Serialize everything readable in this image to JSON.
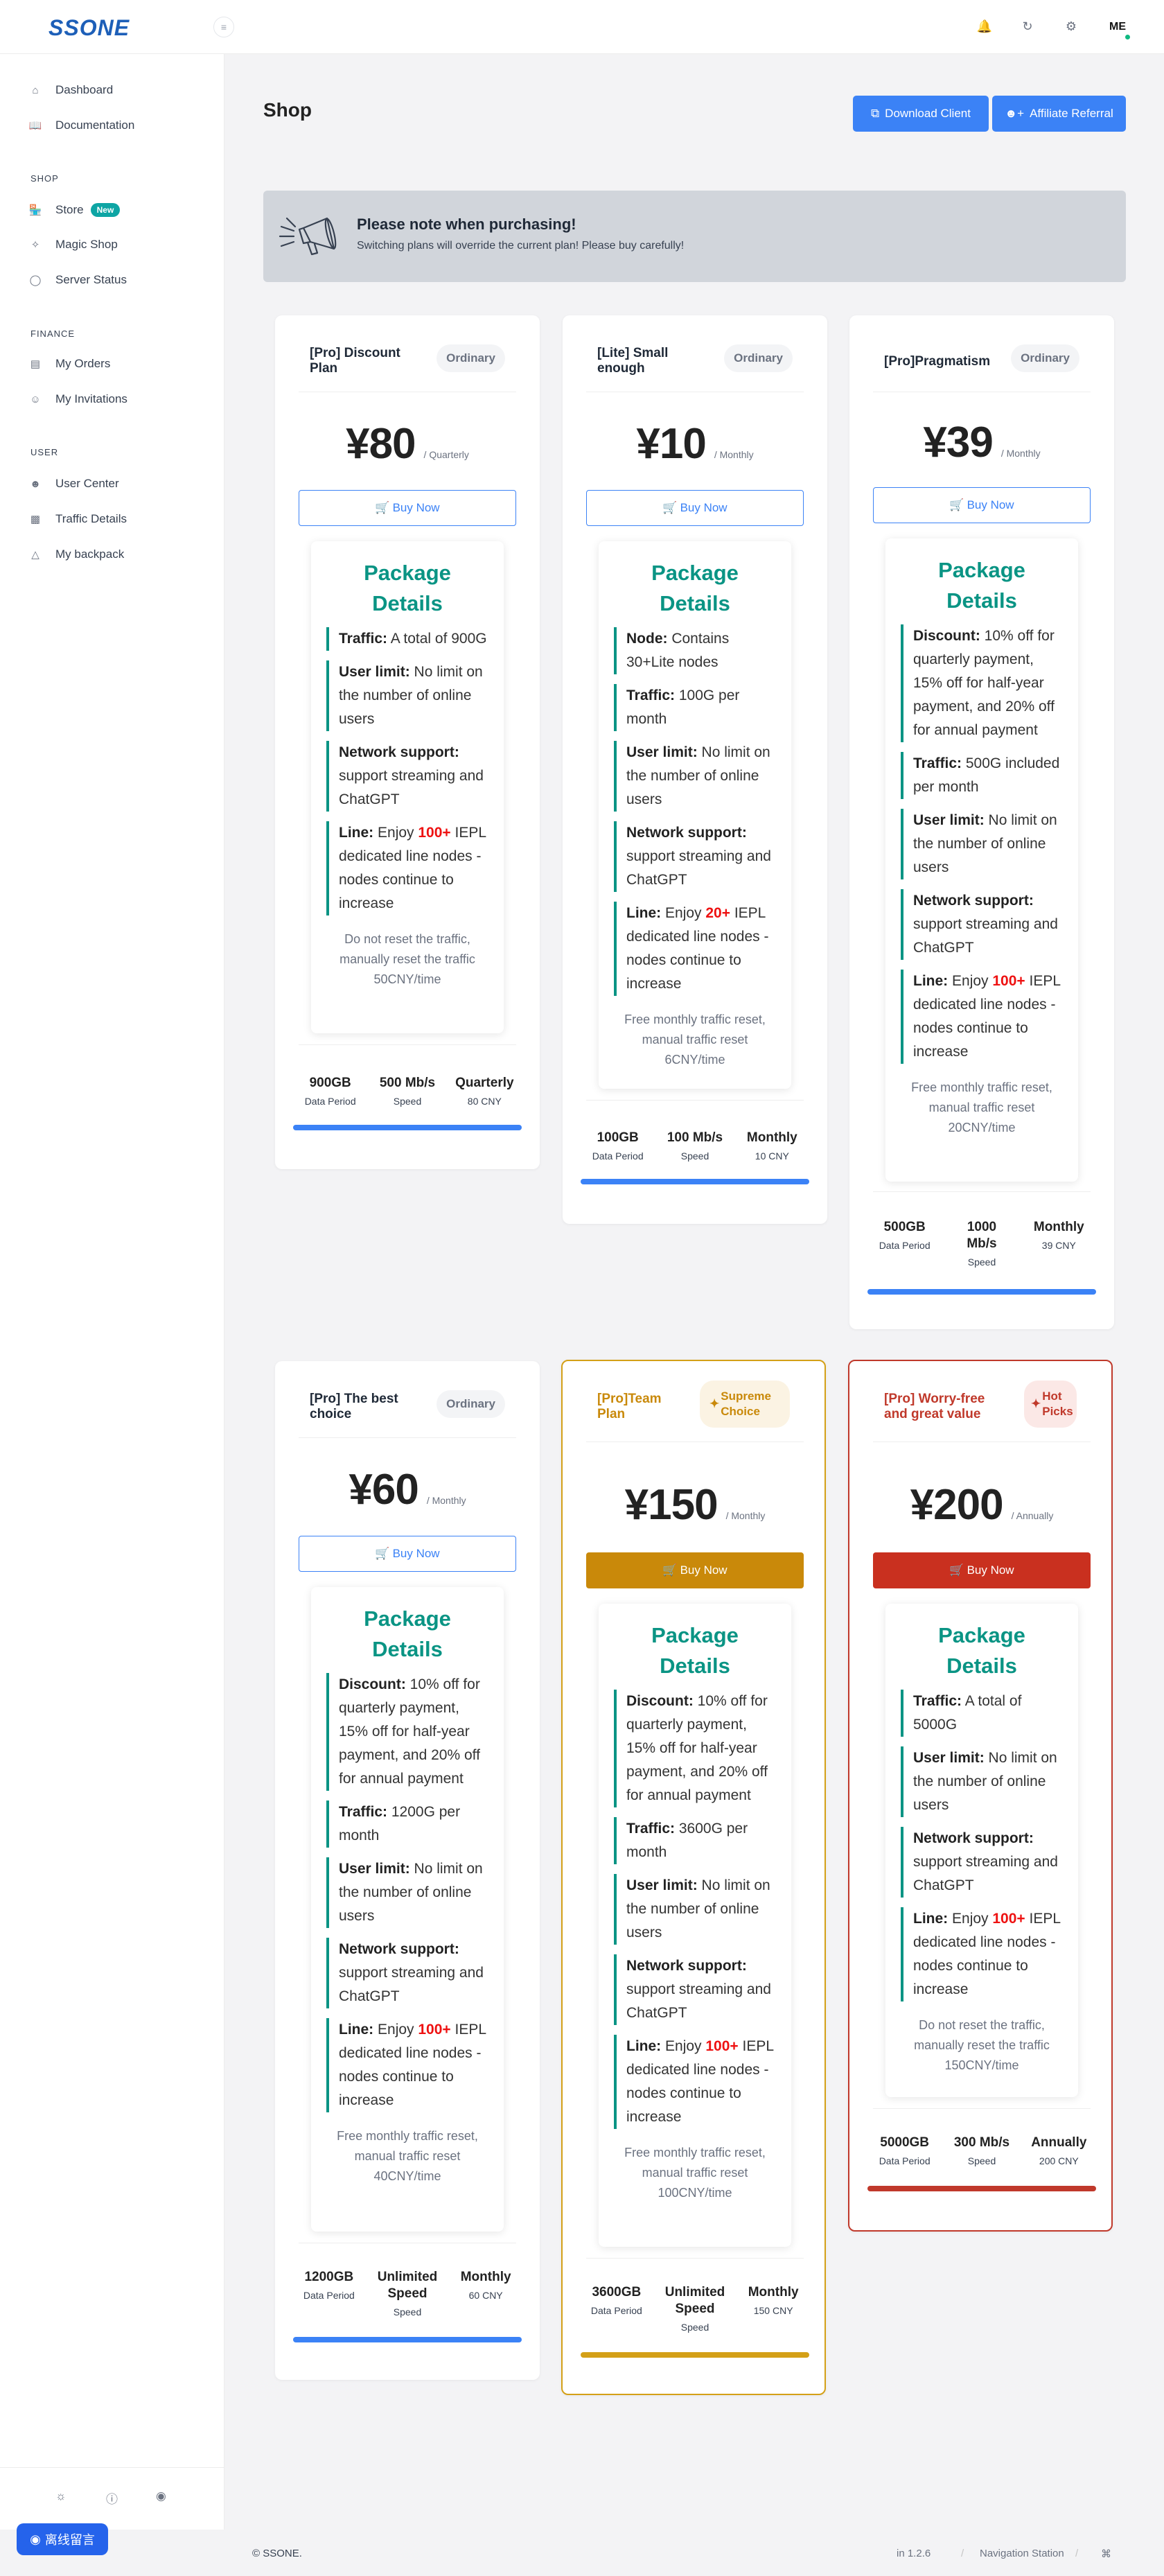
{
  "app": {
    "logo": "SSONE",
    "avatar_initials": "ME"
  },
  "sidebar": {
    "items_main": [
      {
        "label": "Dashboard"
      },
      {
        "label": "Documentation"
      }
    ],
    "sections": {
      "shop": "SHOP",
      "finance": "FINANCE",
      "user": "USER"
    },
    "shop_items": [
      {
        "label": "Store",
        "badge": "New"
      },
      {
        "label": "Magic Shop"
      },
      {
        "label": "Server Status"
      }
    ],
    "finance_items": [
      {
        "label": "My Orders"
      },
      {
        "label": "My Invitations"
      }
    ],
    "user_items": [
      {
        "label": "User Center"
      },
      {
        "label": "Traffic Details"
      },
      {
        "label": "My backpack"
      }
    ],
    "message_button": "离线留言"
  },
  "page": {
    "title": "Shop",
    "download_button": "Download Client",
    "affiliate_button": "Affiliate Referral"
  },
  "notice": {
    "title": "Please note when purchasing!",
    "text": "Switching plans will override the current plan! Please buy carefully!"
  },
  "common": {
    "buy_now": "Buy Now",
    "details_title": "Package Details",
    "data_period_label": "Data Period",
    "speed_label": "Speed"
  },
  "plans": [
    {
      "name": "[Pro] Discount Plan",
      "tag": "Ordinary",
      "price": "¥80",
      "period": "/ Quarterly",
      "features": [
        {
          "k": "Traffic:",
          "v": " A total of 900G"
        },
        {
          "k": "User limit:",
          "v": " No limit on the number of online users"
        },
        {
          "k": "Network support:",
          "v": " support streaming and ChatGPT"
        },
        {
          "k": "Line:",
          "v1": " Enjoy ",
          "hl": "100+",
          "v2": " IEPL dedicated line nodes - nodes continue to increase"
        }
      ],
      "note": "Do not reset the traffic, manually reset the traffic 50CNY/time",
      "stats": {
        "data": "900GB",
        "speed": "500 Mb/s",
        "cycle": "Quarterly",
        "cycle_price": "80 CNY"
      }
    },
    {
      "name": "[Lite] Small enough",
      "tag": "Ordinary",
      "price": "¥10",
      "period": "/ Monthly",
      "features": [
        {
          "k": "Node:",
          "v": " Contains 30+Lite nodes"
        },
        {
          "k": "Traffic:",
          "v": " 100G per month"
        },
        {
          "k": "User limit:",
          "v": " No limit on the number of online users"
        },
        {
          "k": "Network support:",
          "v": " support streaming and ChatGPT"
        },
        {
          "k": "Line:",
          "v1": " Enjoy ",
          "hl": "20+",
          "v2": " IEPL dedicated line nodes - nodes continue to increase"
        }
      ],
      "note": "Free monthly traffic reset, manual traffic reset 6CNY/time",
      "stats": {
        "data": "100GB",
        "speed": "100 Mb/s",
        "cycle": "Monthly",
        "cycle_price": "10 CNY"
      }
    },
    {
      "name": "[Pro]Pragmatism",
      "tag": "Ordinary",
      "price": "¥39",
      "period": "/ Monthly",
      "features": [
        {
          "k": "Discount:",
          "v": " 10% off for quarterly payment, 15% off for half-year payment, and 20% off for annual payment"
        },
        {
          "k": "Traffic:",
          "v": " 500G included per month"
        },
        {
          "k": "User limit:",
          "v": " No limit on the number of online users"
        },
        {
          "k": "Network support:",
          "v": " support streaming and ChatGPT"
        },
        {
          "k": "Line:",
          "v1": " Enjoy ",
          "hl": "100+",
          "v2": " IEPL dedicated line nodes - nodes continue to increase"
        }
      ],
      "note": "Free monthly traffic reset, manual traffic reset 20CNY/time",
      "stats": {
        "data": "500GB",
        "speed": "1000 Mb/s",
        "cycle": "Monthly",
        "cycle_price": "39 CNY"
      }
    },
    {
      "name": "[Pro] The best choice",
      "tag": "Ordinary",
      "price": "¥60",
      "period": "/ Monthly",
      "features": [
        {
          "k": "Discount:",
          "v": " 10% off for quarterly payment, 15% off for half-year payment, and 20% off for annual payment"
        },
        {
          "k": "Traffic:",
          "v": " 1200G per month"
        },
        {
          "k": "User limit:",
          "v": " No limit on the number of online users"
        },
        {
          "k": "Network support:",
          "v": " support streaming and ChatGPT"
        },
        {
          "k": "Line:",
          "v1": " Enjoy ",
          "hl": "100+",
          "v2": " IEPL dedicated line nodes - nodes continue to increase"
        }
      ],
      "note": "Free monthly traffic reset, manual traffic reset 40CNY/time",
      "stats": {
        "data": "1200GB",
        "speed": "Unlimited Speed",
        "cycle": "Monthly",
        "cycle_price": "60 CNY"
      }
    },
    {
      "name": "[Pro]Team Plan",
      "tag": "Supreme Choice",
      "price": "¥150",
      "period": "/ Monthly",
      "features": [
        {
          "k": "Discount:",
          "v": " 10% off for quarterly payment, 15% off for half-year payment, and 20% off for annual payment"
        },
        {
          "k": "Traffic:",
          "v": " 3600G per month"
        },
        {
          "k": "User limit:",
          "v": " No limit on the number of online users"
        },
        {
          "k": "Network support:",
          "v": " support streaming and ChatGPT"
        },
        {
          "k": "Line:",
          "v1": " Enjoy ",
          "hl": "100+",
          "v2": " IEPL dedicated line nodes - nodes continue to increase"
        }
      ],
      "note": "Free monthly traffic reset, manual traffic reset 100CNY/time",
      "stats": {
        "data": "3600GB",
        "speed": "Unlimited Speed",
        "cycle": "Monthly",
        "cycle_price": "150 CNY"
      }
    },
    {
      "name": "[Pro] Worry-free and great value",
      "tag": "Hot Picks",
      "price": "¥200",
      "period": "/ Annually",
      "features": [
        {
          "k": "Traffic:",
          "v": " A total of 5000G"
        },
        {
          "k": "User limit:",
          "v": " No limit on the number of online users"
        },
        {
          "k": "Network support:",
          "v": " support streaming and ChatGPT"
        },
        {
          "k": "Line:",
          "v1": " Enjoy ",
          "hl": "100+",
          "v2": " IEPL dedicated line nodes - nodes continue to increase"
        }
      ],
      "note": "Do not reset the traffic, manually reset the traffic 150CNY/time",
      "stats": {
        "data": "5000GB",
        "speed": "300 Mb/s",
        "cycle": "Annually",
        "cycle_price": "200 CNY"
      }
    }
  ],
  "footer": {
    "copyright": "© SSONE.",
    "version": "in 1.2.6",
    "nav": "Navigation Station",
    "sep": "/"
  },
  "colors": {
    "accent": "#3b82f6",
    "teal": "#0a9484",
    "gold": "#c9890a",
    "red": "#c0392b",
    "highlight": "#e11111"
  },
  "icons": [
    "home-icon",
    "book-icon",
    "shop-icon",
    "magic-icon",
    "shield-icon",
    "orders-icon",
    "invitations-icon",
    "user-icon",
    "traffic-icon",
    "backpack-icon",
    "bell-icon",
    "refresh-icon",
    "settings-icon",
    "sun-icon",
    "info-icon",
    "flag-icon",
    "megaphone-icon",
    "cart-icon",
    "download-icon",
    "user-plus-icon",
    "command-icon"
  ]
}
